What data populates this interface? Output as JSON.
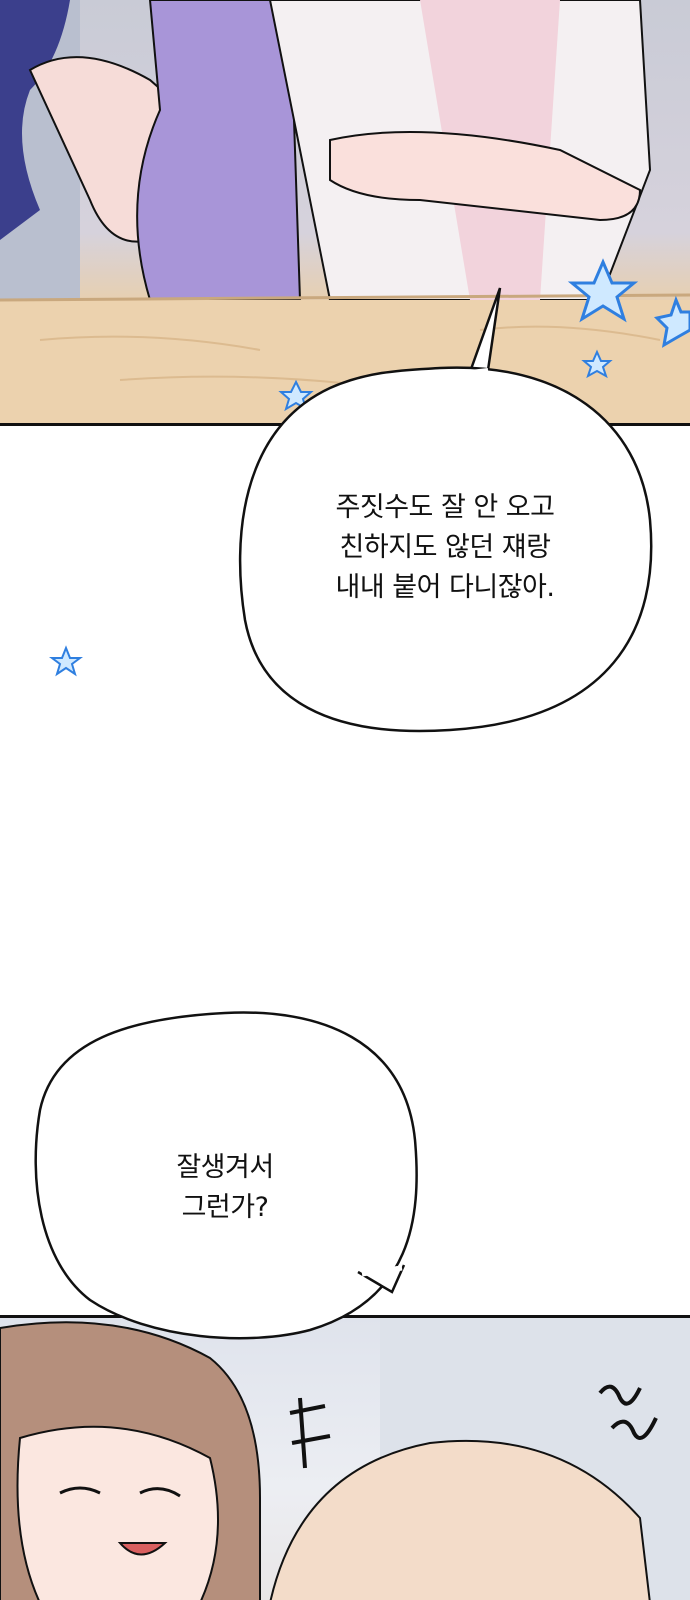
{
  "panels": [
    {
      "id": "top-panel"
    },
    {
      "id": "bottom-panel"
    }
  ],
  "bubbles": [
    {
      "lines": [
        "주짓수도 잘 안 오고",
        "친하지도 않던 쟤랑",
        "내내 붙어 다니잖아."
      ]
    },
    {
      "lines": [
        "잘생겨서",
        "그런가?"
      ]
    }
  ],
  "colors": {
    "star_blue": "#2f7fe0",
    "star_light": "#cfe9ff",
    "outline": "#111111"
  }
}
